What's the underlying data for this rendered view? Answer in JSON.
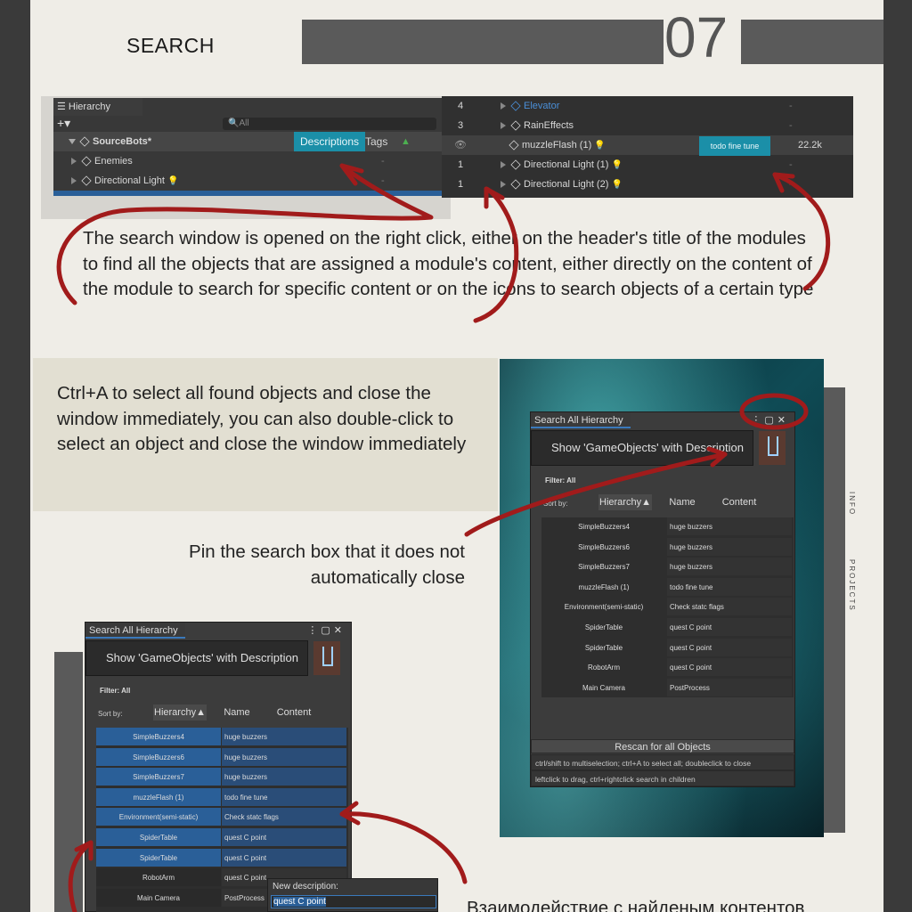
{
  "header": {
    "title": "SEARCH",
    "number": "07"
  },
  "hierarchy_left": {
    "tab": "Hierarchy",
    "search_placeholder": "All",
    "root": "SourceBots*",
    "descriptions_btn": "Descriptions",
    "tags_label": "Tags",
    "items": [
      {
        "label": "Enemies",
        "dash": "-"
      },
      {
        "label": "Directional Light",
        "dash": "-"
      }
    ]
  },
  "hierarchy_right": {
    "rows": [
      {
        "num": "4",
        "label": "Elevator",
        "extra": "-",
        "size": "-"
      },
      {
        "num": "3",
        "label": "RainEffects",
        "extra": "-",
        "size": "-"
      },
      {
        "num": "",
        "label": "muzzleFlash (1)",
        "extra": "todo fine tune",
        "size": "22.2k"
      },
      {
        "num": "1",
        "label": "Directional Light (1)",
        "extra": "-",
        "size": "-"
      },
      {
        "num": "1",
        "label": "Directional Light (2)",
        "extra": "-",
        "size": "-"
      }
    ]
  },
  "paragraphs": {
    "search_window": "The search window is opened on the right click, either on the header's title of the modules to find all the objects that are assigned a module's content, either directly on the content of the module to search for specific content or on the icons to search objects of a certain type",
    "ctrl_a": "Ctrl+A to select all found objects and close the window immediately, you can also double-click to select an object and close the window immediately",
    "pin": "Pin the search box that it does not automatically close",
    "interaction": "Взаимодействие с найденым контентов"
  },
  "search_panel": {
    "tab": "Search All Hierarchy",
    "input": "Show 'GameObjects' with Description",
    "filter": "Filter: All",
    "sort_by": "Sort by:",
    "sort_hierarchy": "Hierarchy▲",
    "sort_name": "Name",
    "sort_content": "Content",
    "rows": [
      {
        "name": "SimpleBuzzers4",
        "content": "huge buzzers"
      },
      {
        "name": "SimpleBuzzers6",
        "content": "huge buzzers"
      },
      {
        "name": "SimpleBuzzers7",
        "content": "huge buzzers"
      },
      {
        "name": "muzzleFlash (1)",
        "content": "todo fine tune"
      },
      {
        "name": "Environment(semi-static)",
        "content": "Check statc flags"
      },
      {
        "name": "SpiderTable",
        "content": "quest C point"
      },
      {
        "name": "SpiderTable",
        "content": "quest C point"
      },
      {
        "name": "RobotArm",
        "content": "quest C point"
      },
      {
        "name": "Main Camera",
        "content": "PostProcess"
      }
    ],
    "rescan": "Rescan for all Objects",
    "hint1": "ctrl/shift to multiselection; ctrl+A to select all; doubleclick to close",
    "hint2": "leftclick to drag, ctrl+rightclick search in children"
  },
  "edit_popup": {
    "label": "New description:",
    "value": "quest C point"
  },
  "side_labels": {
    "info": "INFO",
    "projects": "PROJECTS"
  },
  "colors": {
    "arrow": "#a11b1b",
    "selected_row": "#2a5f98",
    "accent": "#1b8fa8"
  }
}
